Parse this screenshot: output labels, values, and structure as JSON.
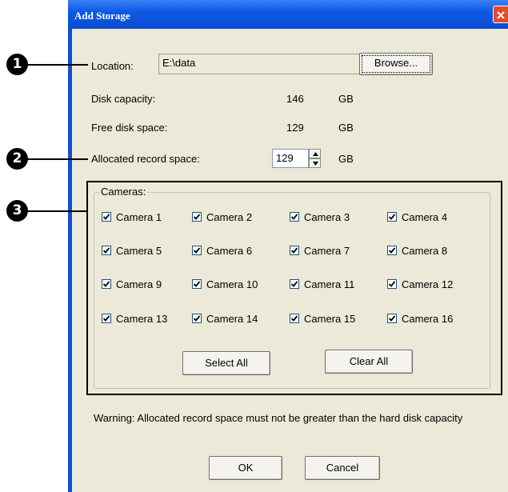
{
  "window": {
    "title": "Add Storage",
    "close_icon": "close-icon",
    "title_color": "#0a4bd1",
    "client_color": "#ece9d8"
  },
  "callouts": [
    "1",
    "2",
    "3"
  ],
  "location": {
    "label": "Location:",
    "value": "E:\\data",
    "browse_label": "Browse..."
  },
  "disk_capacity": {
    "label": "Disk capacity:",
    "value": "146",
    "unit": "GB"
  },
  "free_space": {
    "label": "Free disk space:",
    "value": "129",
    "unit": "GB"
  },
  "allocated": {
    "label": "Allocated record space:",
    "value": "129",
    "unit": "GB"
  },
  "cameras": {
    "group_label": "Cameras:",
    "items": [
      {
        "label": "Camera 1",
        "checked": true
      },
      {
        "label": "Camera 2",
        "checked": true
      },
      {
        "label": "Camera 3",
        "checked": true
      },
      {
        "label": "Camera 4",
        "checked": true
      },
      {
        "label": "Camera 5",
        "checked": true
      },
      {
        "label": "Camera 6",
        "checked": true
      },
      {
        "label": "Camera 7",
        "checked": true
      },
      {
        "label": "Camera 8",
        "checked": true
      },
      {
        "label": "Camera 9",
        "checked": true
      },
      {
        "label": "Camera 10",
        "checked": true
      },
      {
        "label": "Camera 11",
        "checked": true
      },
      {
        "label": "Camera 12",
        "checked": true
      },
      {
        "label": "Camera 13",
        "checked": true
      },
      {
        "label": "Camera 14",
        "checked": true
      },
      {
        "label": "Camera 15",
        "checked": true
      },
      {
        "label": "Camera 16",
        "checked": true
      }
    ],
    "select_all_label": "Select All",
    "clear_all_label": "Clear All"
  },
  "warning": "Warning: Allocated record space must not be greater than the hard disk capacity",
  "buttons": {
    "ok": "OK",
    "cancel": "Cancel"
  }
}
